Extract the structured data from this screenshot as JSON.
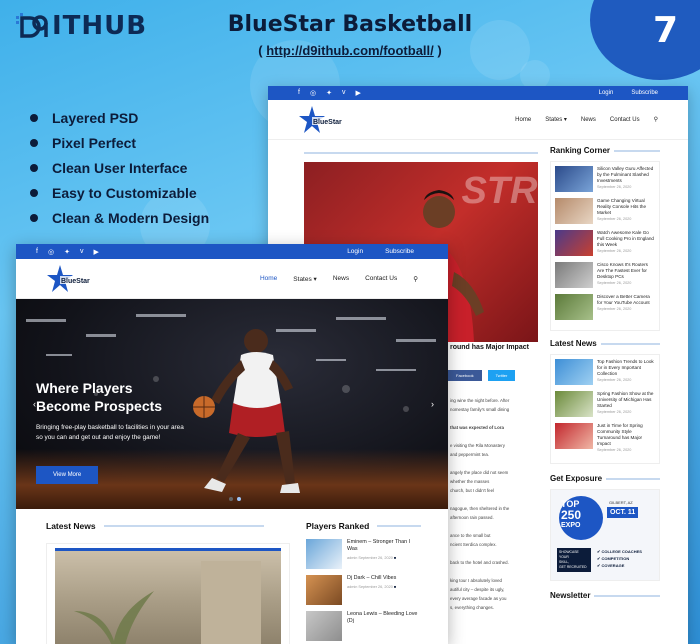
{
  "promo": {
    "logo_text": "ITHUB",
    "title": "BlueStar Basketball",
    "url_open": "( ",
    "url": "http://d9ithub.com/football/",
    "url_close": " )",
    "badge_number": "7",
    "features": [
      "Layered PSD",
      "Pixel Perfect",
      "Clean User Interface",
      "Easy to Customizable",
      "Clean & Modern Design"
    ]
  },
  "topbar": {
    "login": "Login",
    "subscribe": "Subscribe"
  },
  "nav": {
    "home": "Home",
    "states": "States",
    "news": "News",
    "contact": "Contact Us"
  },
  "hero": {
    "title_line1": "Where Players",
    "title_line2": "Become Prospects",
    "description": "Bringing free-play basketball to facilities in your area so you can and get out and enjoy the game!",
    "button": "View More"
  },
  "front_sections": {
    "latest_news": "Latest News",
    "players_ranked": "Players Ranked",
    "players": [
      {
        "title": "Eminem – Stronger Than I Was",
        "author": "admin",
        "date": "September 26, 2020",
        "colors": [
          "#6aa6d9",
          "#e9f1f9"
        ]
      },
      {
        "title": "Dj Dark – Chill Vibes",
        "author": "admin",
        "date": "September 26, 2020",
        "colors": [
          "#d59252",
          "#7b4a23"
        ]
      },
      {
        "title": "Leona Lewis – Bleeding Love (Dj",
        "author": "",
        "date": "",
        "colors": [
          "#c7c7c7",
          "#8e8e8e"
        ]
      }
    ]
  },
  "back_page": {
    "article_title": "round has Major Impact",
    "share_facebook": "Facebook",
    "share_twitter": "Twitter",
    "photo_word": "STRI",
    "article_lines": [
      "ing wine the night before. After",
      "nomestay family's small dining",
      "",
      "that was expected of Lora",
      "",
      "e visiting the Rila Monastery",
      "and peppermint tea.",
      "",
      "angely the place did not seem",
      "whether the masses",
      "church, but I didn't feel",
      "",
      "nagogue, then sheltered in the",
      "afternoon rain passed.",
      "",
      "ance to the small but",
      "ncient Serdica complex.",
      "",
      "back to the hotel and crashed.",
      "",
      "king tour I absolutely loved",
      "autiful city – despite its ugly,",
      "every average facade as you",
      "s, everything changes."
    ],
    "ranking_corner": "Ranking Corner",
    "ranking": [
      {
        "title": "Silicon Valley Guru Affected by the Fulminant Slashed Investments",
        "date": "September 26, 2020",
        "colors": [
          "#2b4a8a",
          "#7aa4d8"
        ]
      },
      {
        "title": "Game Changing Virtual Reality Console Hits the Market",
        "date": "September 26, 2020",
        "colors": [
          "#b58a6a",
          "#e8d6c4"
        ]
      },
      {
        "title": "Watch Awesome Kale Go Full Cooking Pro in England this Week",
        "date": "September 26, 2020",
        "colors": [
          "#4a3a8a",
          "#c9402f"
        ]
      },
      {
        "title": "Cisco Knows It's Routers Are The Fastest Ever for Desktop PCs",
        "date": "September 26, 2020",
        "colors": [
          "#7a7a7a",
          "#cfcfcf"
        ]
      },
      {
        "title": "Discover a Better Camera for Your YouTube Account",
        "date": "September 26, 2020",
        "colors": [
          "#5c7a3a",
          "#a7c08a"
        ]
      }
    ],
    "latest_news": "Latest News",
    "latest": [
      {
        "title": "Top Fashion Trends to Look for in Every Important Collection",
        "date": "September 26, 2020",
        "colors": [
          "#3e8fd6",
          "#9fd0f2"
        ]
      },
      {
        "title": "Spring Fashion Show at the University of Michigan Has Started",
        "date": "September 26, 2020",
        "colors": [
          "#6b8a3a",
          "#d9e3c7"
        ]
      },
      {
        "title": "Just in Time for Spring Community Style Turnaround has Major Impact",
        "date": "September 26, 2020",
        "colors": [
          "#c2272d",
          "#f0b7a6"
        ]
      }
    ],
    "get_exposure": "Get Exposure",
    "ad": {
      "top": "TOP",
      "num": "250",
      "expo": "EXPO",
      "location": "GILBERT, AZ",
      "date": "OCT. 11",
      "line1": "COLLEGE COACHES",
      "line2": "COMPETITION",
      "line3": "COVERAGE",
      "side1": "SHOWCASE YOUR",
      "side2": "SKILL,",
      "side3": "GET RECRUITED"
    },
    "newsletter": "Newsletter"
  },
  "colors": {
    "brand": "#1d56c4",
    "navy": "#0c1c3a"
  }
}
